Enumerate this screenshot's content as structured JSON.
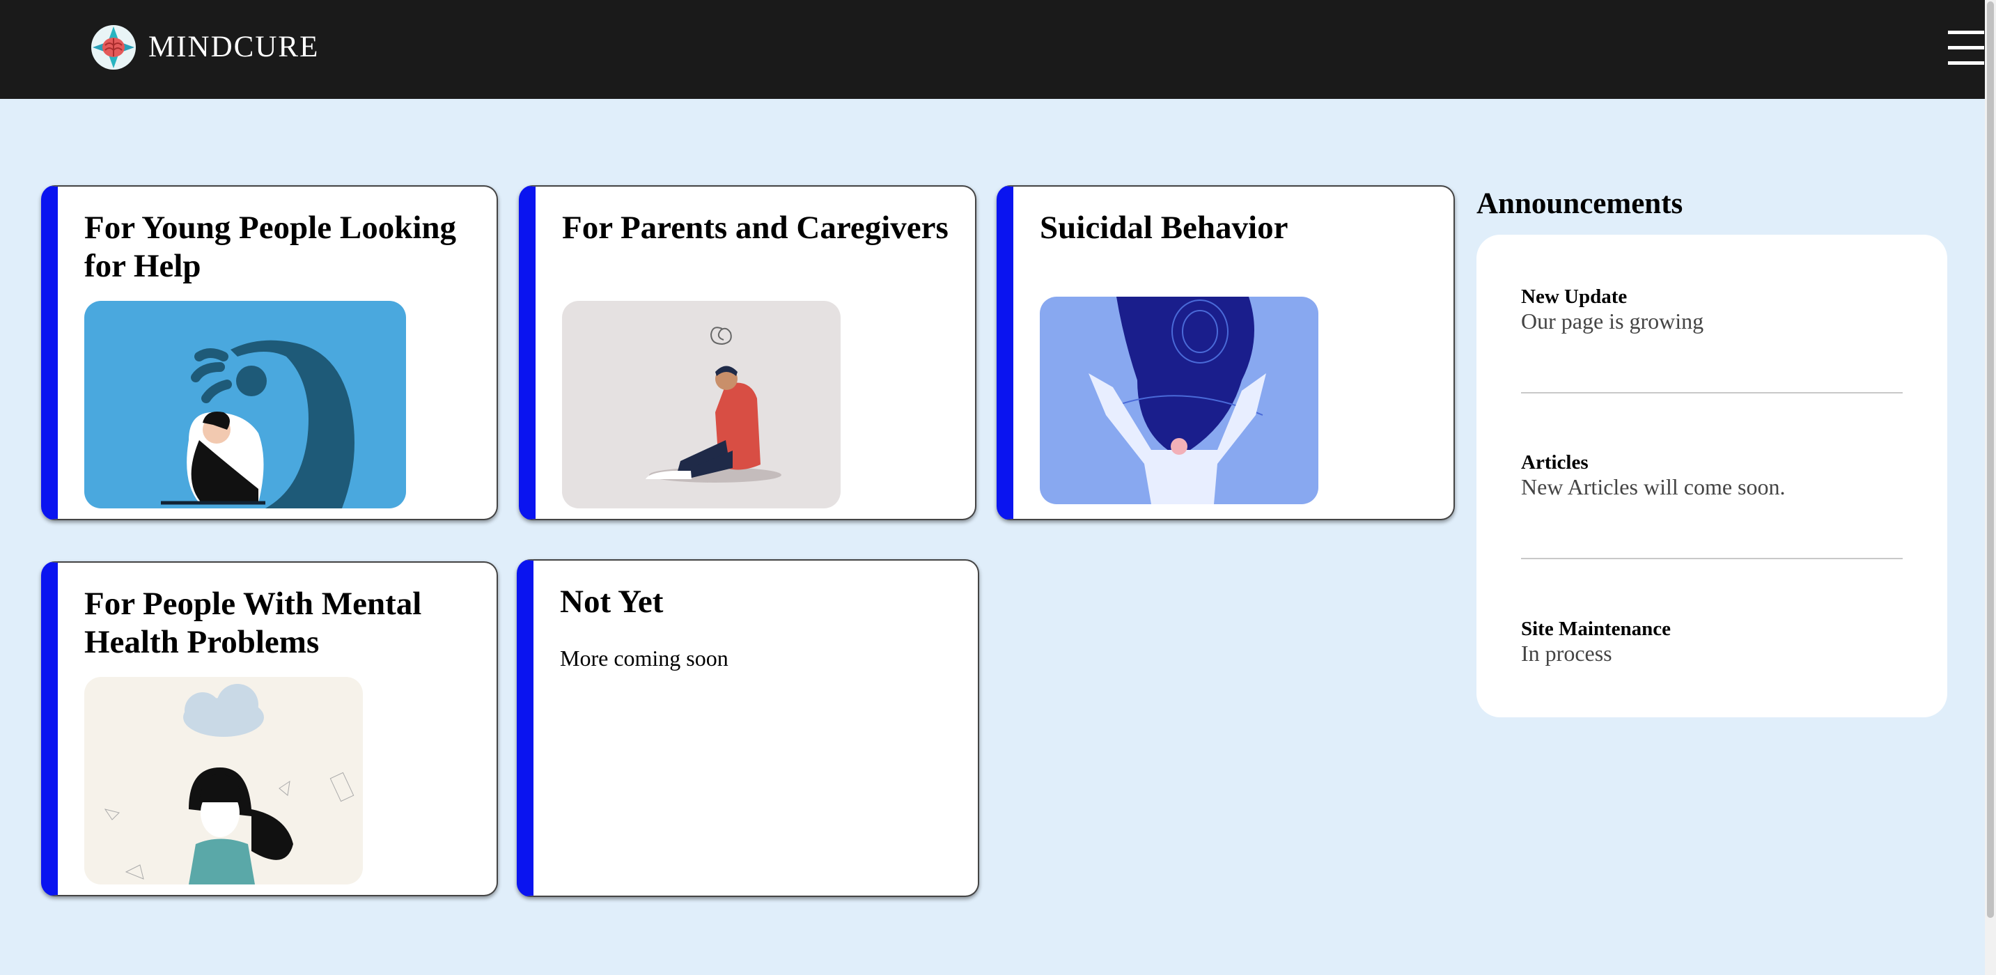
{
  "nav": {
    "brand": "MINDCURE",
    "logo_icon": "brain-logo-icon",
    "menu_icon": "hamburger-menu-icon"
  },
  "colors": {
    "navbar": "#1a1a1a",
    "page_background": "#e0eefa",
    "card_accent": "#0a14f0",
    "card_background": "#ffffff"
  },
  "cards": [
    {
      "title": "For Young People Looking for Help",
      "illustration": "person-hugging-knees-with-shadow-monster"
    },
    {
      "title": "For Parents and Caregivers",
      "illustration": "person-sitting-with-scribble-thought"
    },
    {
      "title": "Suicidal Behavior",
      "illustration": "woman-with-tangled-flowing-hair"
    },
    {
      "title": "For People With Mental Health Problems",
      "illustration": "girl-under-rain-cloud"
    },
    {
      "title": "Not Yet",
      "text": "More coming soon"
    }
  ],
  "announcements": {
    "heading": "Announcements",
    "items": [
      {
        "title": "New Update",
        "description": "Our page is growing"
      },
      {
        "title": "Articles",
        "description": "New Articles will come soon."
      },
      {
        "title": "Site Maintenance",
        "description": "In process"
      }
    ]
  }
}
